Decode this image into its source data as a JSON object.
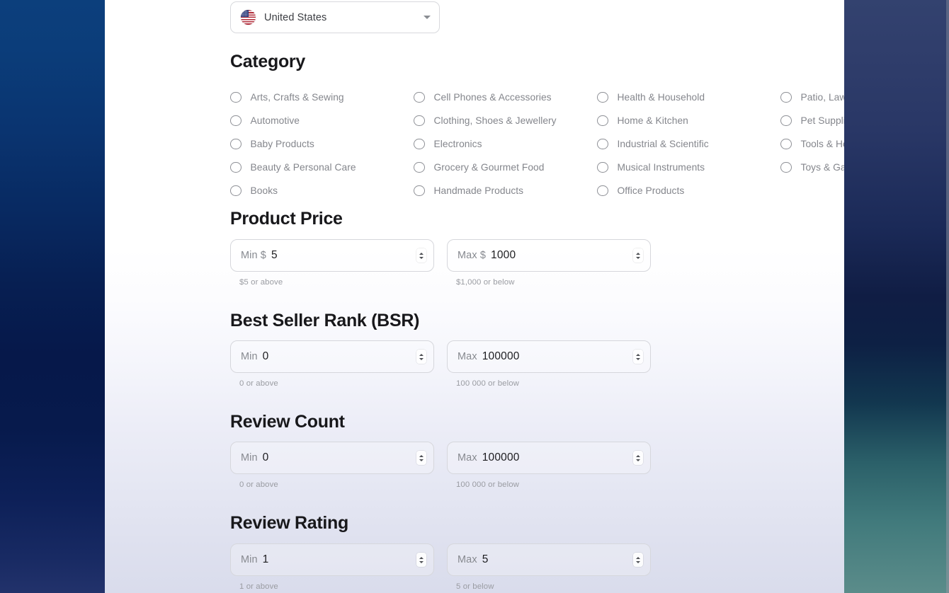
{
  "colors": {
    "sidebar_top": "#0c3f7c",
    "sidebar_bottom": "#22326b",
    "right_panel_top": "#33426f",
    "right_panel_bottom": "#5b8c8a",
    "heading": "#18181b",
    "muted_text": "#84868c",
    "helper_text": "#9a9ca2",
    "border": "#d6d7dc"
  },
  "country_select": {
    "value": "United States",
    "flag_icon": "us-flag-icon",
    "caret_icon": "chevron-down-icon"
  },
  "sections": {
    "category": {
      "title": "Category",
      "columns": [
        [
          "Arts, Crafts & Sewing",
          "Automotive",
          "Baby Products",
          "Beauty & Personal Care",
          "Books"
        ],
        [
          "Cell Phones & Accessories",
          "Clothing, Shoes & Jewellery",
          "Electronics",
          "Grocery & Gourmet Food",
          "Handmade Products"
        ],
        [
          "Health & Household",
          "Home & Kitchen",
          "Industrial & Scientific",
          "Musical Instruments",
          "Office Products"
        ],
        [
          "Patio, Lawn & Garden",
          "Pet Supplies",
          "Tools & Home Improvement",
          "Toys & Games"
        ]
      ]
    },
    "product_price": {
      "title": "Product Price",
      "min": {
        "prefix": "Min $",
        "value": "5",
        "helper": "$5 or above"
      },
      "max": {
        "prefix": "Max $",
        "value": "1000",
        "helper": "$1,000 or below"
      }
    },
    "bsr": {
      "title": "Best Seller Rank (BSR)",
      "min": {
        "prefix": "Min",
        "value": "0",
        "helper": "0 or above"
      },
      "max": {
        "prefix": "Max",
        "value": "100000",
        "helper": "100 000 or below"
      }
    },
    "review_count": {
      "title": "Review Count",
      "min": {
        "prefix": "Min",
        "value": "0",
        "helper": "0 or above"
      },
      "max": {
        "prefix": "Max",
        "value": "100000",
        "helper": "100 000 or below"
      }
    },
    "review_rating": {
      "title": "Review Rating",
      "min": {
        "prefix": "Min",
        "value": "1",
        "helper": "1 or above"
      },
      "max": {
        "prefix": "Max",
        "value": "5",
        "helper": "5 or below"
      }
    }
  }
}
